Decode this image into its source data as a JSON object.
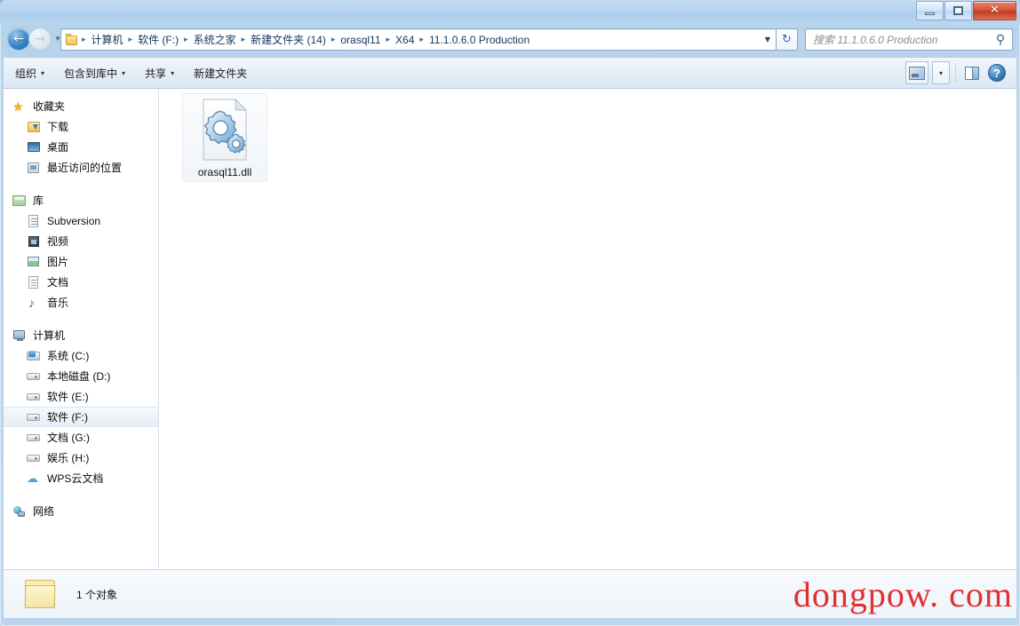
{
  "window": {
    "buttons": {
      "minimize": "minimize",
      "maximize": "maximize",
      "close": "✕"
    }
  },
  "address_bar": {
    "back_label": "←",
    "forward_label": "→",
    "history_caret": "▼",
    "dropdown_caret": "▼",
    "refresh_label": "↻",
    "breadcrumbs": [
      "计算机",
      "软件 (F:)",
      "系统之家",
      "新建文件夹 (14)",
      "orasql11",
      "X64",
      "11.1.0.6.0 Production"
    ],
    "separator": "▸"
  },
  "search": {
    "placeholder": "搜索 11.1.0.6.0 Production",
    "value": "",
    "icon": "⚲"
  },
  "toolbar": {
    "items": [
      {
        "label": "组织",
        "caret": "▾"
      },
      {
        "label": "包含到库中",
        "caret": "▾"
      },
      {
        "label": "共享",
        "caret": "▾"
      },
      {
        "label": "新建文件夹",
        "caret": ""
      }
    ],
    "views_caret": "▾",
    "help_label": "?"
  },
  "sidebar": {
    "groups": [
      {
        "header": {
          "label": "收藏夹",
          "icon": "star-icon",
          "name": "favorites"
        },
        "items": [
          {
            "label": "下载",
            "icon": "downloads-icon",
            "name": "downloads"
          },
          {
            "label": "桌面",
            "icon": "desktop-icon",
            "name": "desktop"
          },
          {
            "label": "最近访问的位置",
            "icon": "recent-places-icon",
            "name": "recent-places"
          }
        ]
      },
      {
        "header": {
          "label": "库",
          "icon": "library-icon",
          "name": "libraries"
        },
        "items": [
          {
            "label": "Subversion",
            "icon": "document-icon",
            "name": "subversion"
          },
          {
            "label": "视频",
            "icon": "video-icon",
            "name": "videos"
          },
          {
            "label": "图片",
            "icon": "picture-icon",
            "name": "pictures"
          },
          {
            "label": "文档",
            "icon": "document-icon",
            "name": "documents"
          },
          {
            "label": "音乐",
            "icon": "music-icon",
            "name": "music"
          }
        ]
      },
      {
        "header": {
          "label": "计算机",
          "icon": "computer-icon",
          "name": "computer"
        },
        "items": [
          {
            "label": "系统 (C:)",
            "icon": "system-drive-icon",
            "name": "drive-c",
            "selected": false
          },
          {
            "label": "本地磁盘 (D:)",
            "icon": "drive-icon",
            "name": "drive-d",
            "selected": false
          },
          {
            "label": "软件 (E:)",
            "icon": "drive-icon",
            "name": "drive-e",
            "selected": false
          },
          {
            "label": "软件 (F:)",
            "icon": "drive-icon",
            "name": "drive-f",
            "selected": true
          },
          {
            "label": "文档 (G:)",
            "icon": "drive-icon",
            "name": "drive-g",
            "selected": false
          },
          {
            "label": "娱乐 (H:)",
            "icon": "drive-icon",
            "name": "drive-h",
            "selected": false
          },
          {
            "label": "WPS云文档",
            "icon": "cloud-icon",
            "name": "wps-cloud",
            "selected": false
          }
        ]
      },
      {
        "header": {
          "label": "网络",
          "icon": "network-icon",
          "name": "network"
        },
        "items": []
      }
    ]
  },
  "content": {
    "files": [
      {
        "name": "orasql11.dll",
        "icon": "dll-file-icon"
      }
    ]
  },
  "status": {
    "text": "1 个对象",
    "folder_icon": "folder-icon"
  },
  "watermark": {
    "text": "dongpow. com",
    "color": "#e03030"
  }
}
